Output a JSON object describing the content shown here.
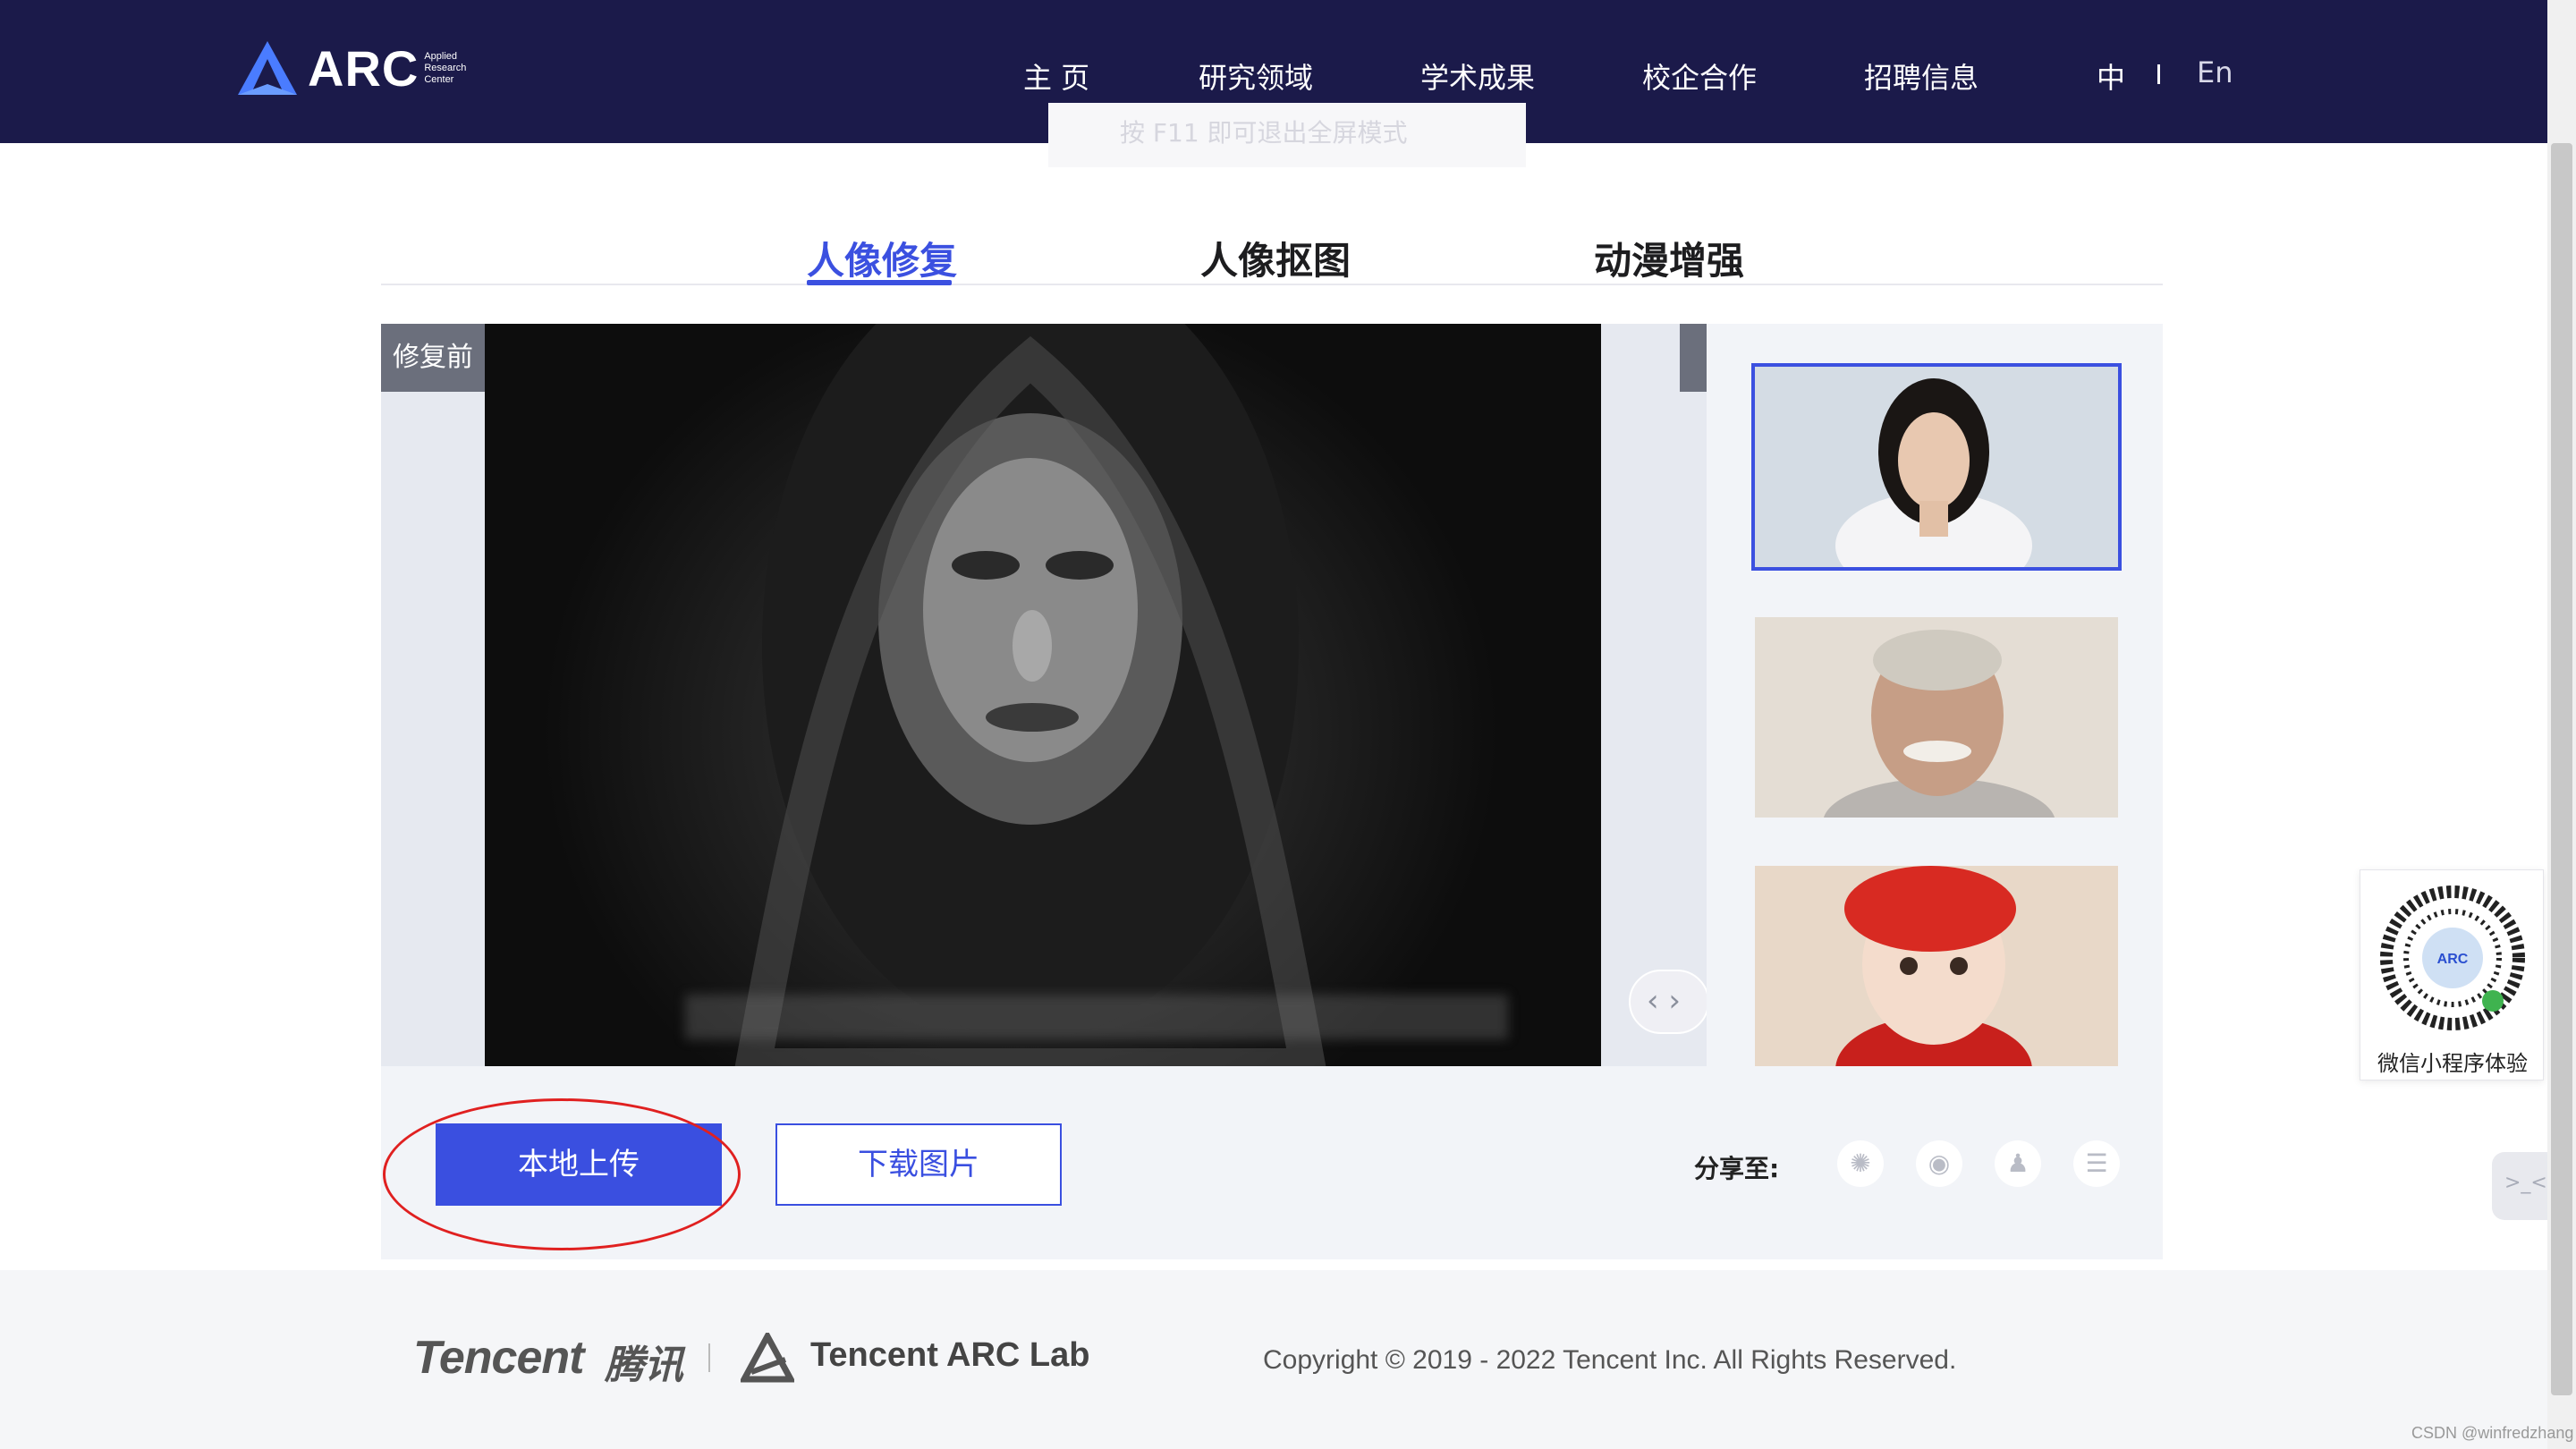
{
  "header": {
    "logo_text": "ARC",
    "logo_sub": [
      "Applied",
      "Research",
      "Center"
    ],
    "nav": [
      {
        "label": "主 页"
      },
      {
        "label": "研究领域"
      },
      {
        "label": "学术成果"
      },
      {
        "label": "校企合作"
      },
      {
        "label": "招聘信息"
      }
    ],
    "lang_zh": "中",
    "lang_en": "En",
    "fullscreen_tip": "按 F11 即可退出全屏模式"
  },
  "tabs": [
    {
      "label": "人像修复",
      "active": true
    },
    {
      "label": "人像抠图",
      "active": false
    },
    {
      "label": "动漫增强",
      "active": false
    }
  ],
  "viewer": {
    "before_label": "修复前",
    "slider_glyph": "‹ ›"
  },
  "thumbnails": [
    {
      "name": "young-woman",
      "selected": true
    },
    {
      "name": "older-man",
      "selected": false
    },
    {
      "name": "baby-red-hat",
      "selected": false
    }
  ],
  "actions": {
    "upload_label": "本地上传",
    "download_label": "下载图片",
    "share_label": "分享至:"
  },
  "share_icons": [
    "qzone-icon",
    "weibo-icon",
    "qq-icon",
    "douban-icon"
  ],
  "footer": {
    "tencent": "Tencent",
    "tencent_cn": "腾讯",
    "lab": "Tencent ARC Lab",
    "copyright": "Copyright © 2019 - 2022 Tencent Inc. All Rights Reserved."
  },
  "qr": {
    "caption": "微信小程序体验",
    "center_text": "ARC"
  },
  "watermark": "CSDN @winfredzhang",
  "colors": {
    "nav_bg": "#1b1a4a",
    "accent": "#3b50e0",
    "annotation": "#e02020"
  }
}
